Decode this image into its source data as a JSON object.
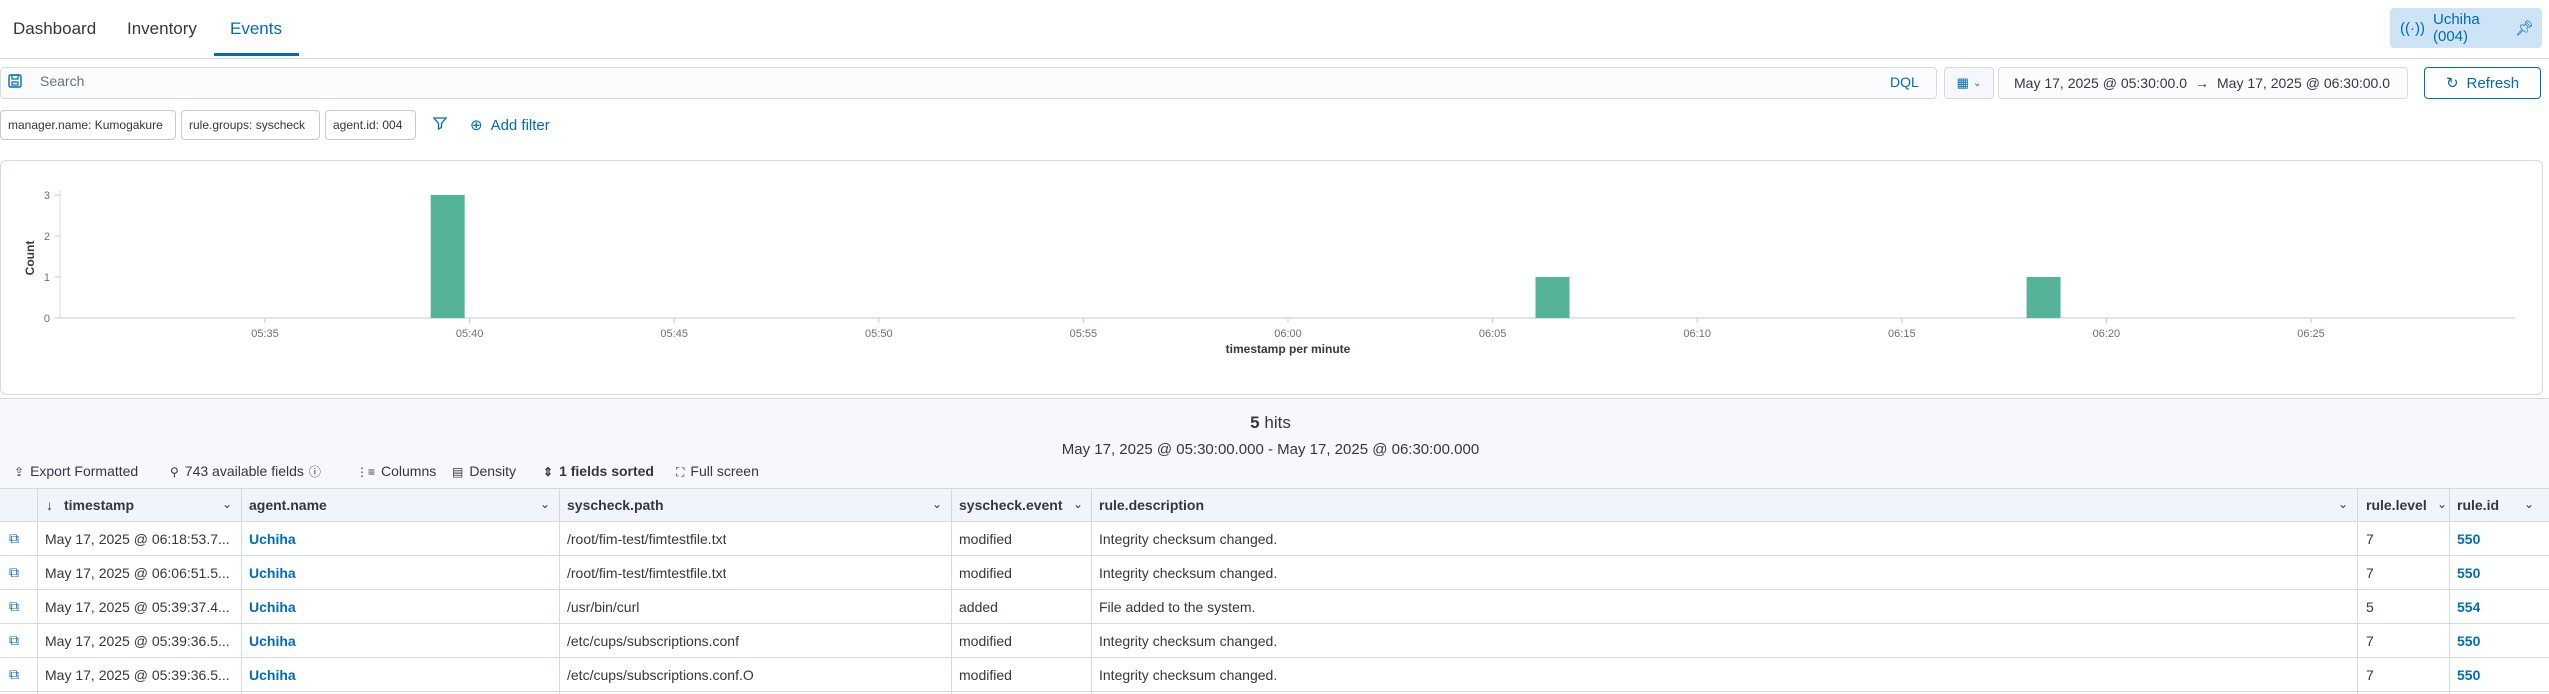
{
  "tabs": [
    {
      "label": "Dashboard"
    },
    {
      "label": "Inventory"
    },
    {
      "label": "Events"
    }
  ],
  "agent_selector": {
    "label": "Uchiha (004)",
    "icon": "broadcast-icon",
    "pin_icon": "pin-icon"
  },
  "search": {
    "placeholder": "Search",
    "query_language": "DQL"
  },
  "date_range": {
    "start": "May 17, 2025 @ 05:30:00.0",
    "arrow": "→",
    "end": "May 17, 2025 @ 06:30:00.0"
  },
  "refresh_label": "Refresh",
  "filters": [
    {
      "label": "manager.name: Kumogakure"
    },
    {
      "label": "rule.groups: syscheck"
    },
    {
      "label": "agent.id: 004"
    }
  ],
  "add_filter_label": "Add filter",
  "chart_data": {
    "type": "bar",
    "ylabel": "Count",
    "xlabel": "timestamp per minute",
    "y_ticks": [
      "0",
      "1",
      "2",
      "3"
    ],
    "ylim": [
      0,
      3
    ],
    "x_ticks": [
      "05:35",
      "05:40",
      "05:45",
      "05:50",
      "05:55",
      "06:00",
      "06:05",
      "06:10",
      "06:15",
      "06:20",
      "06:25"
    ],
    "categories": [
      "05:39",
      "06:06",
      "06:18"
    ],
    "values": [
      3,
      1,
      1
    ],
    "bar_color": "#54b399"
  },
  "hits": {
    "count": "5",
    "suffix": " hits",
    "range": "May 17, 2025 @ 05:30:00.000 - May 17, 2025 @ 06:30:00.000"
  },
  "table_toolbar": {
    "export": "Export Formatted",
    "fields": "743 available fields",
    "columns": "Columns",
    "density": "Density",
    "sorted": "1 fields sorted",
    "fullscreen": "Full screen"
  },
  "table": {
    "columns": [
      "timestamp",
      "agent.name",
      "syscheck.path",
      "syscheck.event",
      "rule.description",
      "rule.level",
      "rule.id"
    ],
    "rows": [
      [
        "May 17, 2025 @ 06:18:53.7...",
        "Uchiha",
        "/root/fim-test/fimtestfile.txt",
        "modified",
        "Integrity checksum changed.",
        "7",
        "550"
      ],
      [
        "May 17, 2025 @ 06:06:51.5...",
        "Uchiha",
        "/root/fim-test/fimtestfile.txt",
        "modified",
        "Integrity checksum changed.",
        "7",
        "550"
      ],
      [
        "May 17, 2025 @ 05:39:37.4...",
        "Uchiha",
        "/usr/bin/curl",
        "added",
        "File added to the system.",
        "5",
        "554"
      ],
      [
        "May 17, 2025 @ 05:39:36.5...",
        "Uchiha",
        "/etc/cups/subscriptions.conf",
        "modified",
        "Integrity checksum changed.",
        "7",
        "550"
      ],
      [
        "May 17, 2025 @ 05:39:36.5...",
        "Uchiha",
        "/etc/cups/subscriptions.conf.O",
        "modified",
        "Integrity checksum changed.",
        "7",
        "550"
      ]
    ]
  },
  "colors": {
    "accent": "#006bb8",
    "bar": "#54b399"
  }
}
